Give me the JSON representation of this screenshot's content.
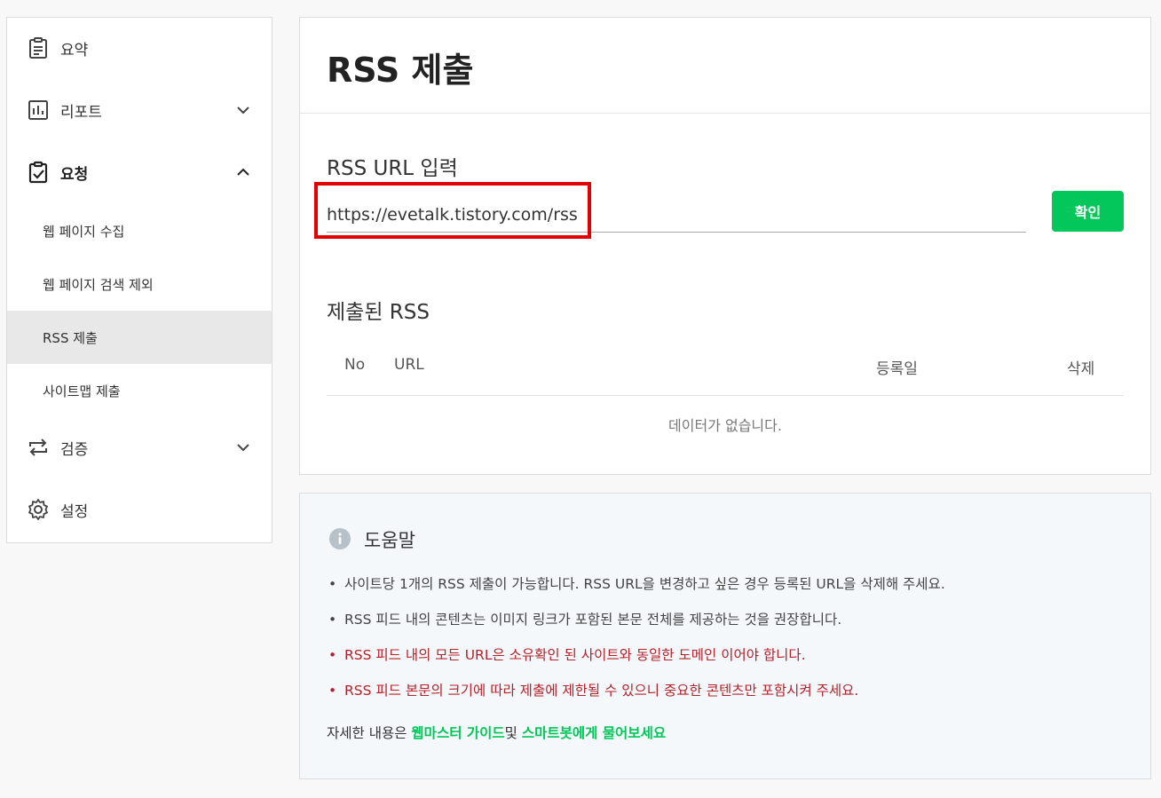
{
  "sidebar": {
    "items": [
      {
        "label": "요약",
        "icon": "clipboard-icon"
      },
      {
        "label": "리포트",
        "icon": "bar-chart-icon"
      },
      {
        "label": "요청",
        "icon": "clipboard-check-icon"
      },
      {
        "label": "검증",
        "icon": "repeat-arrows-icon"
      },
      {
        "label": "설정",
        "icon": "gear-icon"
      }
    ],
    "sub_items": [
      {
        "label": "웹 페이지 수집"
      },
      {
        "label": "웹 페이지 검색 제외"
      },
      {
        "label": "RSS 제출",
        "active": true
      },
      {
        "label": "사이트맵 제출"
      }
    ]
  },
  "main": {
    "title": "RSS 제출",
    "url_section_label": "RSS URL 입력",
    "url_value": "https://evetalk.tistory.com/rss",
    "confirm_label": "확인",
    "submitted_label": "제출된 RSS",
    "table": {
      "headers": [
        "No",
        "URL",
        "등록일",
        "삭제"
      ],
      "empty_text": "데이터가 없습니다."
    }
  },
  "help": {
    "title": "도움말",
    "items": [
      {
        "text": "사이트당 1개의 RSS 제출이 가능합니다. RSS URL을 변경하고 싶은 경우 등록된 URL을 삭제해 주세요.",
        "warn": false
      },
      {
        "text": "RSS 피드 내의 콘텐츠는 이미지 링크가 포함된 본문 전체를 제공하는 것을 권장합니다.",
        "warn": false
      },
      {
        "text": "RSS 피드 내의 모든 URL은 소유확인 된 사이트와 동일한 도메인 이어야 합니다.",
        "warn": true
      },
      {
        "text": "RSS 피드 본문의 크기에 따라 제출에 제한될 수 있으니 중요한 콘텐츠만 포함시켜 주세요.",
        "warn": true
      }
    ],
    "footer_prefix": "자세한 내용은 ",
    "footer_link1": "웹마스터 가이드",
    "footer_mid": "및 ",
    "footer_link2": "스마트봇에게 물어보세요"
  },
  "colors": {
    "accent": "#03c75a",
    "warning": "#b3222a",
    "highlight": "#e30000"
  }
}
